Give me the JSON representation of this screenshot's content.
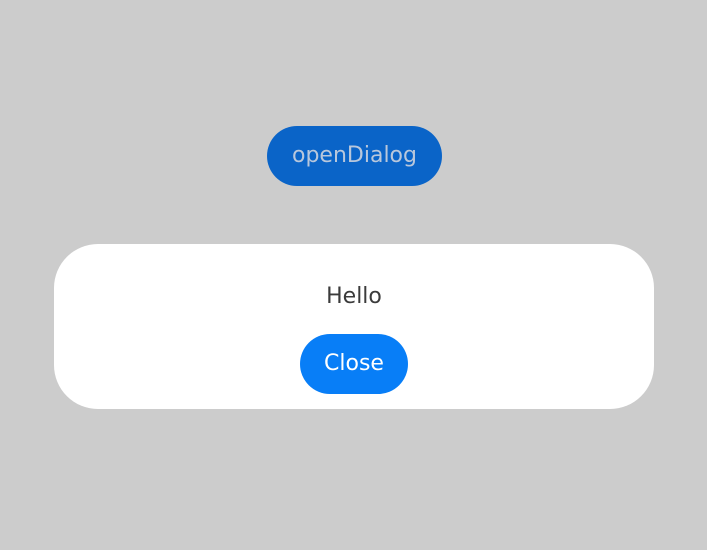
{
  "page": {
    "open_button_label": "openDialog",
    "dialog_message": "Hello",
    "close_button_label": "Close"
  },
  "colors": {
    "background": "#cccccc",
    "open_button": "#0a64c8",
    "close_button": "#087ef7",
    "dialog": "#ffffff"
  }
}
